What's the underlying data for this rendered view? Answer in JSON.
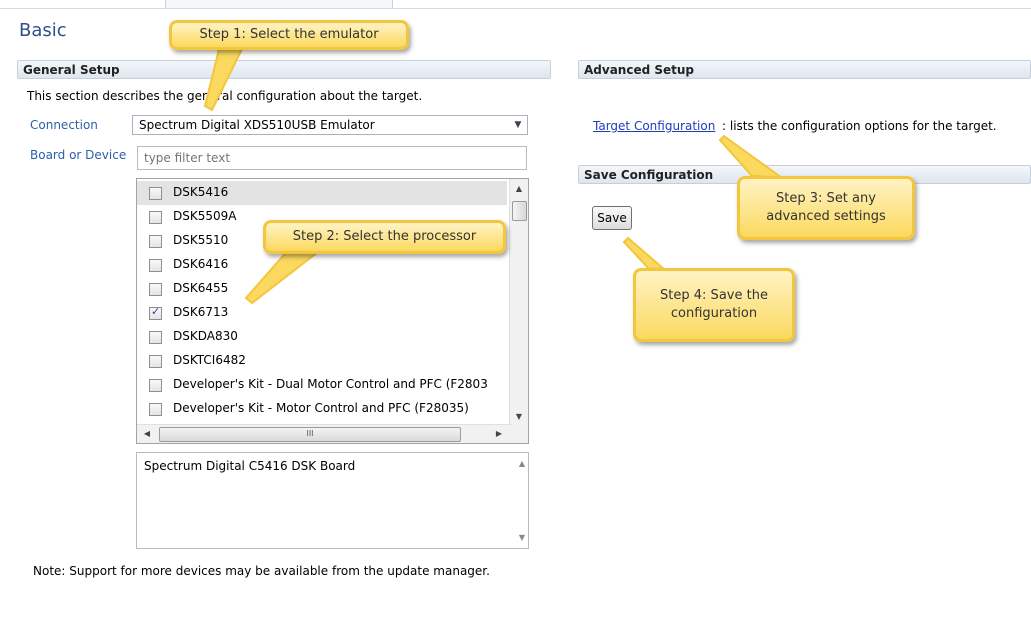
{
  "page": {
    "title": "Basic"
  },
  "general_setup": {
    "header": "General Setup",
    "description": "This section describes the general configuration about the target.",
    "connection_label": "Connection",
    "connection_value": "Spectrum Digital XDS510USB Emulator",
    "board_label": "Board or Device",
    "filter_placeholder": "type filter text",
    "devices": [
      {
        "label": "DSK5416",
        "checked": false
      },
      {
        "label": "DSK5509A",
        "checked": false
      },
      {
        "label": "DSK5510",
        "checked": false
      },
      {
        "label": "DSK6416",
        "checked": false
      },
      {
        "label": "DSK6455",
        "checked": false
      },
      {
        "label": "DSK6713",
        "checked": true
      },
      {
        "label": "DSKDA830",
        "checked": false
      },
      {
        "label": "DSKTCI6482",
        "checked": false
      },
      {
        "label": "Developer's Kit - Dual Motor Control and PFC (F2803",
        "checked": false
      },
      {
        "label": "Developer's Kit - Motor Control and PFC (F28035)",
        "checked": false
      }
    ],
    "hscroll_grip": "III",
    "device_description": "Spectrum Digital C5416 DSK Board",
    "note": "Note: Support for more devices may be available from the update manager."
  },
  "advanced_setup": {
    "header": "Advanced Setup",
    "link_text": "Target Configuration",
    "link_suffix": ": lists the configuration options for the target."
  },
  "save_configuration": {
    "header": "Save Configuration",
    "button_label": "Save"
  },
  "callouts": {
    "step1": "Step 1: Select the emulator",
    "step2": "Step 2: Select the processor",
    "step3": "Step 3: Set any advanced settings",
    "step4": "Step 4: Save the configuration"
  },
  "colors": {
    "callout_fill": "#fbd95e",
    "callout_border": "#f2c63f",
    "link": "#1d3fb8",
    "label_blue": "#2e5fa8",
    "title": "#2f4f8b"
  },
  "icons": [
    "checkbox-icon",
    "scroll-up-arrow-icon",
    "scroll-down-arrow-icon",
    "scroll-left-arrow-icon",
    "scroll-right-arrow-icon",
    "dropdown-arrow-icon"
  ]
}
